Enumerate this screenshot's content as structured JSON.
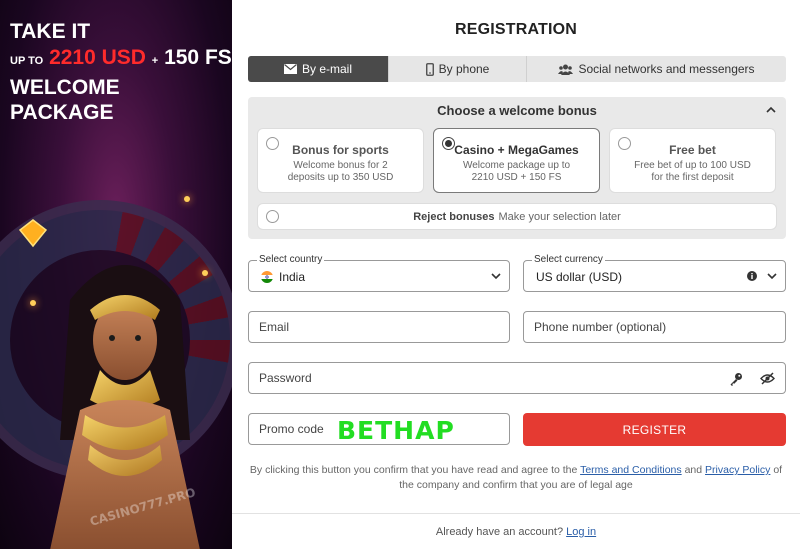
{
  "promo": {
    "line1": "TAKE IT",
    "up_to": "UP TO",
    "amount": "2210 USD",
    "plus": "+",
    "fs": "150 FS",
    "line3": "WELCOME",
    "line4": "PACKAGE",
    "watermark": "CASINO777.PRO"
  },
  "registration": {
    "title": "REGISTRATION",
    "tabs": [
      {
        "label": "By e-mail",
        "icon": "envelope-icon",
        "active": true
      },
      {
        "label": "By phone",
        "icon": "phone-icon",
        "active": false
      },
      {
        "label": "Social networks and messengers",
        "icon": "users-icon",
        "active": false
      }
    ],
    "bonus": {
      "header": "Choose a welcome bonus",
      "options": [
        {
          "title": "Bonus for sports",
          "desc": "Welcome bonus for 2 deposits up to 350 USD",
          "selected": false
        },
        {
          "title": "Casino + MegaGames",
          "desc": "Welcome package up to 2210 USD + 150 FS",
          "selected": true
        },
        {
          "title": "Free bet",
          "desc": "Free bet of up to 100 USD for the first deposit",
          "selected": false
        }
      ],
      "reject_title": "Reject bonuses",
      "reject_hint": "Make your selection later"
    },
    "country": {
      "label": "Select country",
      "value": "India"
    },
    "currency": {
      "label": "Select currency",
      "value": "US dollar (USD)"
    },
    "email": {
      "placeholder": "Email"
    },
    "phone": {
      "placeholder": "Phone number (optional)"
    },
    "password": {
      "placeholder": "Password"
    },
    "promo_code": {
      "placeholder": "Promo code",
      "value": "BETHAP"
    },
    "register_label": "REGISTER",
    "terms": {
      "before": "By clicking this button you confirm that you have read and agree to the",
      "terms_link": "Terms and Conditions",
      "and": "and",
      "privacy_link": "Privacy Policy",
      "after": "of the company and confirm that you are of legal age"
    },
    "login": {
      "text": "Already have an account?",
      "link": "Log in"
    }
  },
  "colors": {
    "accent_red": "#e53a32",
    "promo_amount": "#ff2b2b",
    "promo_code_green": "#22dd22",
    "link_blue": "#2a5ea8",
    "active_tab": "#4a4a4a"
  }
}
